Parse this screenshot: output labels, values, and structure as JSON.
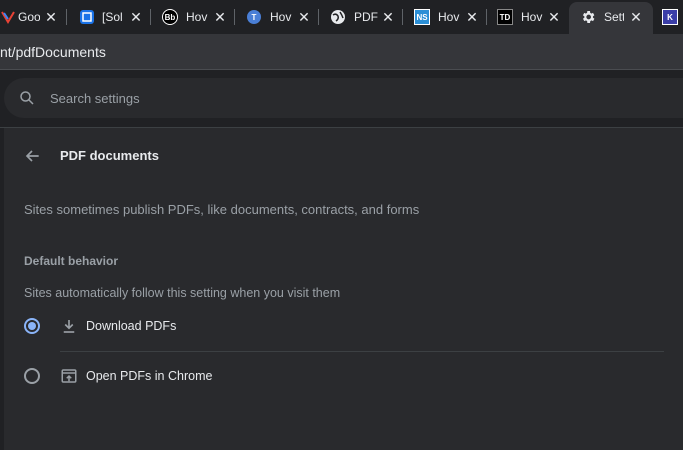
{
  "tabs": [
    {
      "title": "Goo",
      "favicon": "google-favicon",
      "active": false
    },
    {
      "title": "[Sol",
      "favicon": "blue-square-favicon",
      "active": false
    },
    {
      "title": "Hov",
      "favicon": "Bb",
      "active": false
    },
    {
      "title": "Hov",
      "favicon": "blue-circle-favicon",
      "active": false
    },
    {
      "title": "PDF",
      "favicon": "globe-icon",
      "active": false
    },
    {
      "title": "Hov",
      "favicon": "NS",
      "active": false
    },
    {
      "title": "Hov",
      "favicon": "TD",
      "active": false
    },
    {
      "title": "Sett",
      "favicon": "gear-icon",
      "active": true
    },
    {
      "title": "",
      "favicon": "K",
      "active": false
    }
  ],
  "address_bar": {
    "url": "nt/pdfDocuments"
  },
  "search": {
    "placeholder": "Search settings"
  },
  "page": {
    "title": "PDF documents",
    "description": "Sites sometimes publish PDFs, like documents, contracts, and forms",
    "section_title": "Default behavior",
    "section_subtitle": "Sites automatically follow this setting when you visit them",
    "options": [
      {
        "label": "Download PDFs",
        "icon": "download-icon",
        "selected": true
      },
      {
        "label": "Open PDFs in Chrome",
        "icon": "open-in-browser-icon",
        "selected": false
      }
    ]
  },
  "colors": {
    "background": "#202124",
    "card": "#292a2d",
    "accent": "#8ab4f8",
    "text_primary": "#e8eaed",
    "text_secondary": "#9aa0a6"
  }
}
